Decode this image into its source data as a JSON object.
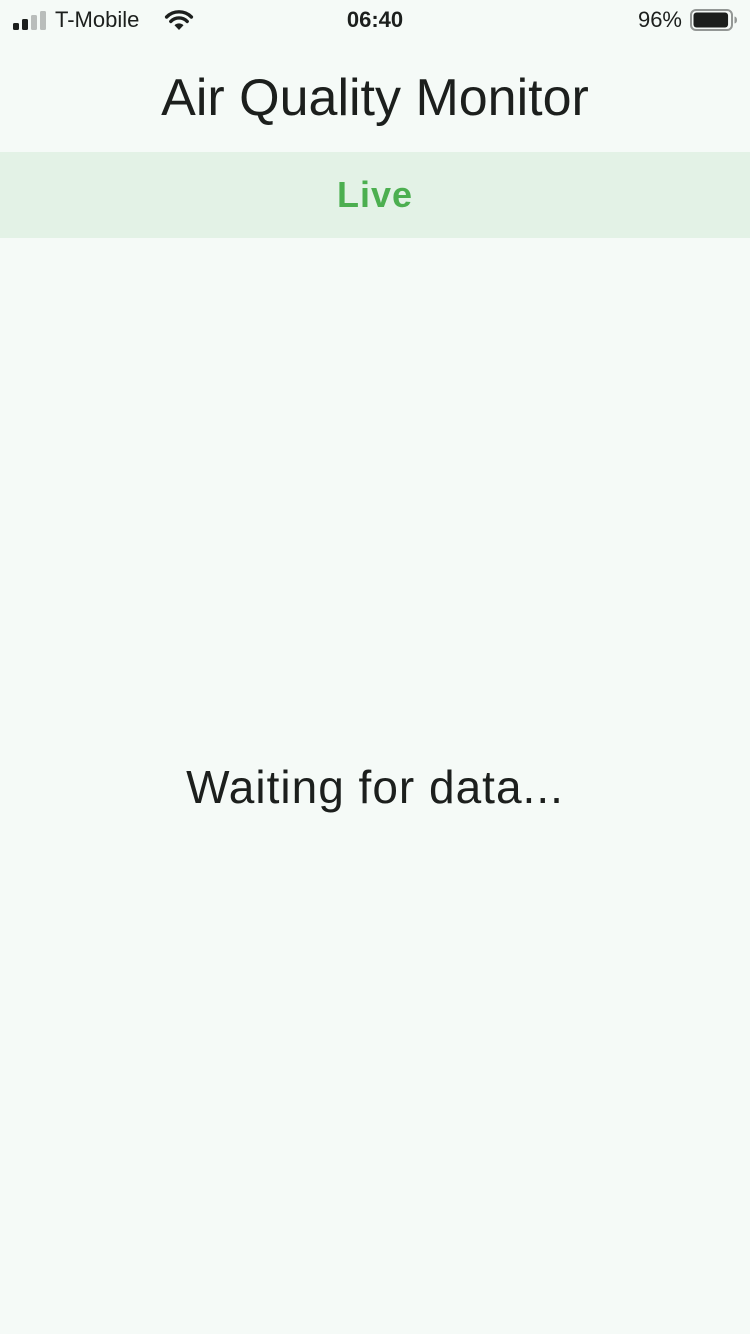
{
  "status_bar": {
    "carrier": "T-Mobile",
    "time": "06:40",
    "battery_percent": "96%",
    "signal_icon": "cellular-signal-icon",
    "wifi_icon": "wifi-icon",
    "battery_icon": "battery-icon",
    "signal_bars_active": 2,
    "signal_bars_total": 4,
    "battery_level": 0.96
  },
  "header": {
    "title": "Air Quality Monitor"
  },
  "mode_bar": {
    "label": "Live",
    "color": "#4caf50",
    "background": "#e3f2e6"
  },
  "main": {
    "status_message": "Waiting for data..."
  }
}
